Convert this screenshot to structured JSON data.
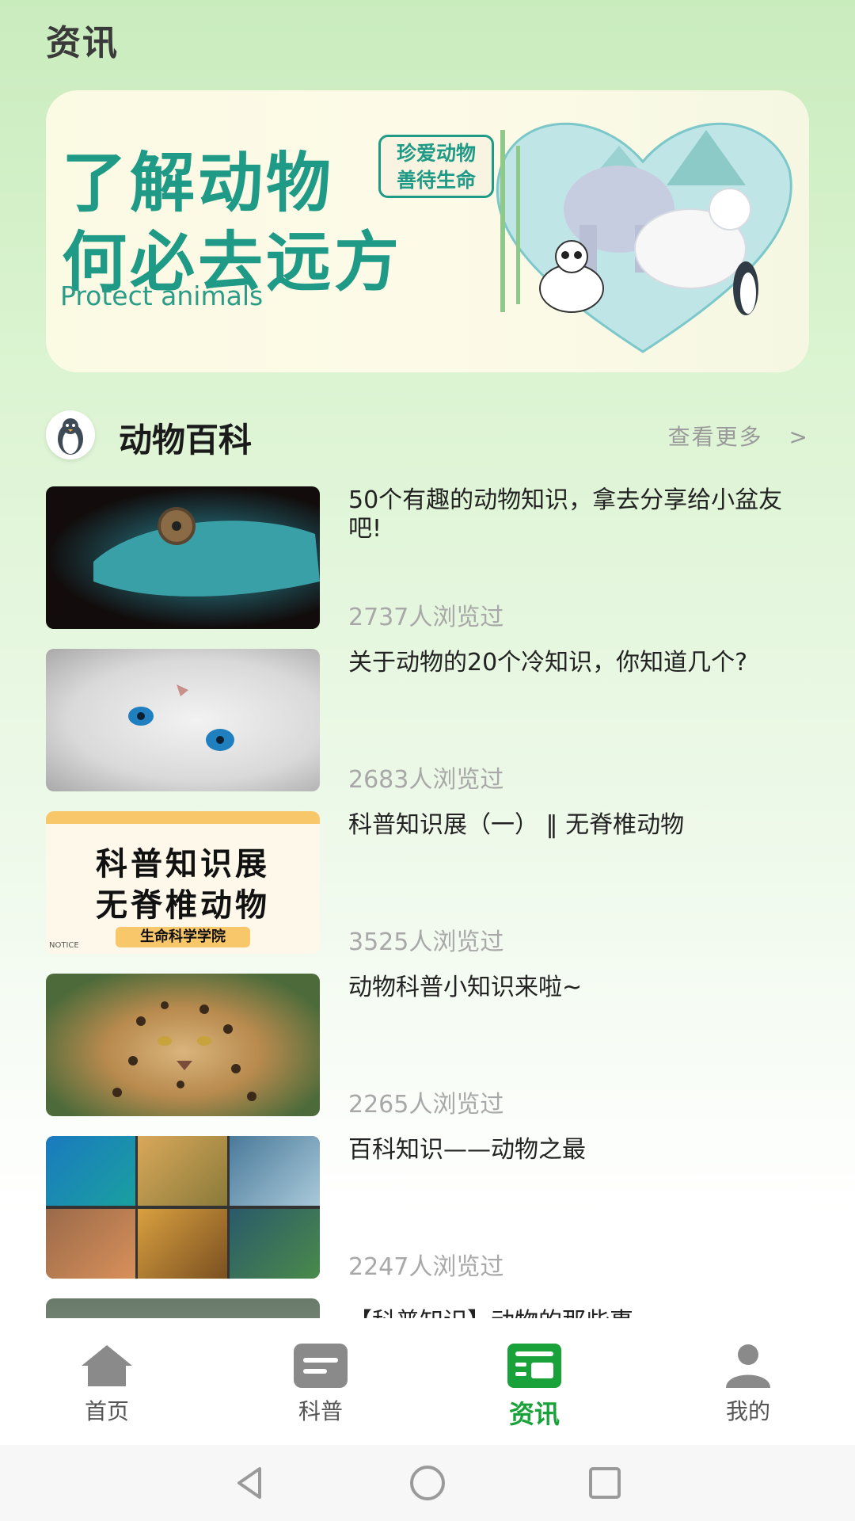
{
  "page": {
    "title": "资讯"
  },
  "banner": {
    "headline1": "了解动物",
    "headline2": "何必去远方",
    "subtitle": "Protect animals",
    "tag_line1": "珍爱动物",
    "tag_line2": "善待生命"
  },
  "section": {
    "title": "动物百科",
    "more_label": "查看更多",
    "more_arrow": ">"
  },
  "articles": [
    {
      "title": "50个有趣的动物知识，拿去分享给小盆友吧!",
      "views": "2737人浏览过"
    },
    {
      "title": "关于动物的20个冷知识，你知道几个?",
      "views": "2683人浏览过"
    },
    {
      "title": "科普知识展（一） ‖ 无脊椎动物",
      "views": "3525人浏览过",
      "thumb_text1": "科普知识展",
      "thumb_text2": "无脊椎动物",
      "thumb_badge": "生命科学学院",
      "thumb_notice": "NOTICE"
    },
    {
      "title": "动物科普小知识来啦~",
      "views": "2265人浏览过"
    },
    {
      "title": "百科知识——动物之最",
      "views": "2247人浏览过"
    },
    {
      "title": "【科普知识】动物的那些事",
      "views": ""
    }
  ],
  "tabbar": {
    "items": [
      {
        "label": "首页",
        "icon": "home-icon",
        "active": false
      },
      {
        "label": "科普",
        "icon": "message-icon",
        "active": false
      },
      {
        "label": "资讯",
        "icon": "news-icon",
        "active": true
      },
      {
        "label": "我的",
        "icon": "user-icon",
        "active": false
      }
    ],
    "active_color": "#1aa23a",
    "inactive_color": "#8a8a8a"
  },
  "system_nav": {
    "icons": [
      "back-icon",
      "home-circle-icon",
      "recents-icon"
    ]
  }
}
